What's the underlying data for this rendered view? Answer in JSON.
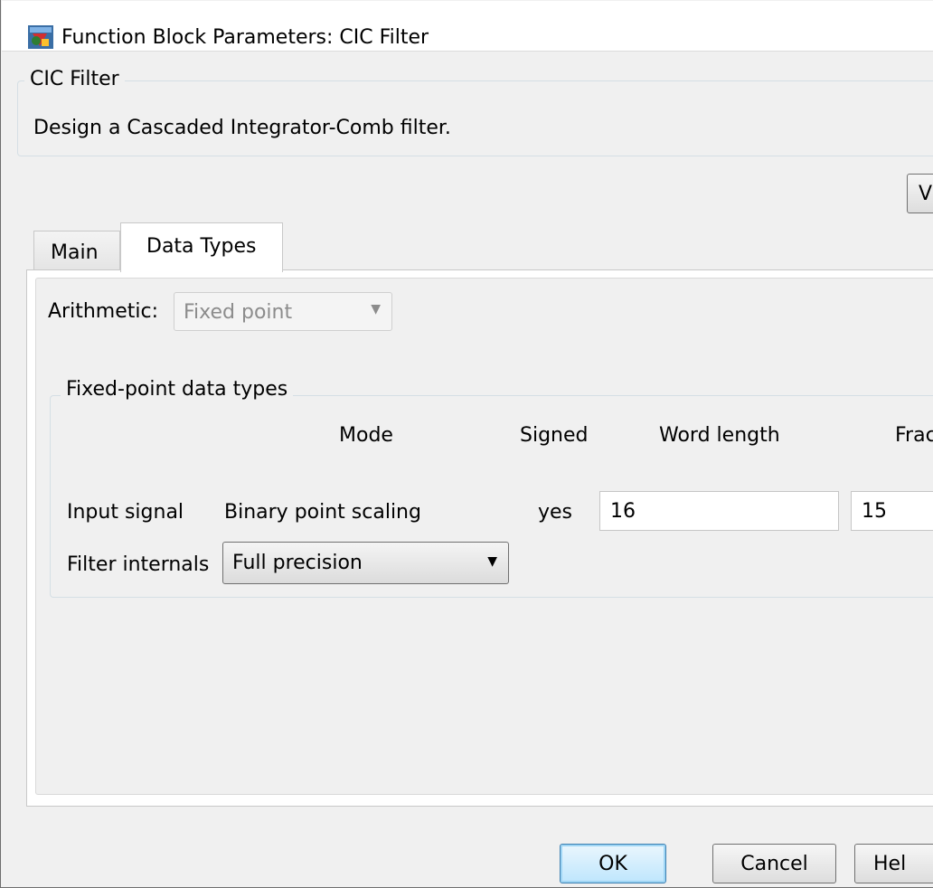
{
  "window": {
    "title": "Function Block Parameters: CIC Filter",
    "icon": "simulink-block-icon"
  },
  "block": {
    "group_title": "CIC Filter",
    "description": "Design a Cascaded Integrator-Comb filter.",
    "view_button_label": "Vi"
  },
  "tabs": [
    {
      "label": "Main",
      "selected": false
    },
    {
      "label": "Data Types",
      "selected": true
    }
  ],
  "arithmetic": {
    "label": "Arithmetic:",
    "value": "Fixed point",
    "disabled": true
  },
  "fixed_point": {
    "group_title": "Fixed-point data types",
    "headers": {
      "mode": "Mode",
      "signed": "Signed",
      "word_length": "Word length",
      "fraction_length": "Frac"
    },
    "input_signal": {
      "label": "Input signal",
      "mode": "Binary point scaling",
      "signed": "yes",
      "word_length": "16",
      "fraction_length": "15"
    },
    "filter_internals": {
      "label": "Filter internals",
      "mode": "Full precision"
    }
  },
  "buttons": {
    "ok": "OK",
    "cancel": "Cancel",
    "help": "Hel"
  },
  "colors": {
    "ok_border": "#3c7fb1",
    "disabled_text": "#8c8c8c"
  }
}
